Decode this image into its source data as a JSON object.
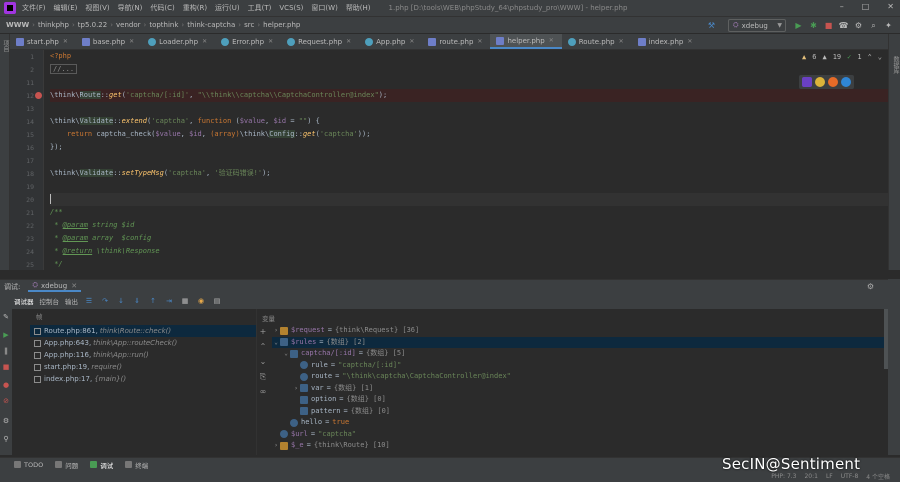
{
  "menubar": {
    "items": [
      "文件(F)",
      "编辑(E)",
      "视图(V)",
      "导航(N)",
      "代码(C)",
      "重构(R)",
      "运行(U)",
      "工具(T)",
      "VCS(S)",
      "窗口(W)",
      "帮助(H)"
    ],
    "title": "1.php [D:\\tools\\WEB\\phpStudy_64\\phpstudy_pro\\WWW] - helper.php"
  },
  "navbar": {
    "breadcrumbs": [
      "WWW",
      "thinkphp",
      "tp5.0.22",
      "vendor",
      "topthink",
      "think-captcha",
      "src",
      "helper.php"
    ],
    "run_config": "xdebug"
  },
  "tabs": [
    "start.php",
    "base.php",
    "Loader.php",
    "Error.php",
    "Request.php",
    "App.php",
    "route.php",
    "helper.php",
    "Route.php",
    "index.php"
  ],
  "active_tab": "helper.php",
  "editor": {
    "inspections": {
      "warnings": "6",
      "weak_warnings": "19",
      "typos": "1"
    },
    "lines": [
      {
        "n": "1",
        "text": "<?php"
      },
      {
        "n": "2",
        "text": "//..."
      },
      {
        "n": "11",
        "text": ""
      },
      {
        "n": "12",
        "text": "\\think\\Route::get('captcha/[:id]', \"\\\\think\\\\captcha\\\\CaptchaController@index\");"
      },
      {
        "n": "13",
        "text": ""
      },
      {
        "n": "14",
        "text": "\\think\\Validate::extend('captcha', function ($value, $id = \"\") {"
      },
      {
        "n": "15",
        "text": "    return captcha_check($value, $id, (array)\\think\\Config::get('captcha'));"
      },
      {
        "n": "16",
        "text": "});"
      },
      {
        "n": "17",
        "text": ""
      },
      {
        "n": "18",
        "text": "\\think\\Validate::setTypeMsg('captcha', '验证码错误!');"
      },
      {
        "n": "19",
        "text": ""
      },
      {
        "n": "20",
        "text": ""
      },
      {
        "n": "21",
        "text": "/**"
      },
      {
        "n": "22",
        "text": " * @param string $id"
      },
      {
        "n": "23",
        "text": " * @param array  $config"
      },
      {
        "n": "24",
        "text": " * @return \\think\\Response"
      },
      {
        "n": "25",
        "text": " */"
      }
    ],
    "code": {
      "l1_tag": "<?php",
      "l2_fold": "//...",
      "l12_ns": "\\think\\",
      "l12_cls": "Route",
      "l12_op": "::",
      "l12_fn": "get",
      "l12_args_open": "(",
      "l12_str1": "'captcha/[:id]'",
      "l12_comma": ", ",
      "l12_str2": "\"\\\\think\\\\captcha\\\\CaptchaController@index\"",
      "l12_close": ");",
      "l14_ns": "\\think\\",
      "l14_cls": "Validate",
      "l14_op": "::",
      "l14_fn": "extend",
      "l14_open": "(",
      "l14_str": "'captcha'",
      "l14_comma": ", ",
      "l14_kw": "function",
      "l14_p1": " (",
      "l14_v1": "$value",
      "l14_p2": ", ",
      "l14_v2": "$id",
      "l14_p3": " = ",
      "l14_str2": "\"\"",
      "l14_p4": ") {",
      "l15_indent": "    ",
      "l15_kw": "return",
      "l15_fn": " captcha_check(",
      "l15_v1": "$value",
      "l15_c1": ", ",
      "l15_v2": "$id",
      "l15_c2": ", ",
      "l15_cast": "(array)",
      "l15_ns": "\\think\\",
      "l15_cls": "Config",
      "l15_op": "::",
      "l15_fn2": "get",
      "l15_open": "(",
      "l15_str": "'captcha'",
      "l15_close": "));",
      "l16": "});",
      "l18_ns": "\\think\\",
      "l18_cls": "Validate",
      "l18_op": "::",
      "l18_fn": "setTypeMsg",
      "l18_open": "(",
      "l18_str1": "'captcha'",
      "l18_comma": ", ",
      "l18_str2": "'验证码错误!'",
      "l18_close": ");",
      "l21": "/**",
      "l22_star": " * ",
      "l22_tag": "@param",
      "l22_rest": " string $id",
      "l23_star": " * ",
      "l23_tag": "@param",
      "l23_rest": " array  $config",
      "l24_star": " * ",
      "l24_tag": "@return",
      "l24_rest": " \\think\\Response",
      "l25": " */"
    }
  },
  "debug": {
    "panel_label": "调试:",
    "session_tab": "xdebug",
    "toolbar": [
      "调试器",
      "控制台",
      "输出"
    ],
    "frames_header": "帧",
    "frames": [
      {
        "loc": "Route.php:861,",
        "method": "think\\Route::check()"
      },
      {
        "loc": "App.php:643,",
        "method": "think\\App::routeCheck()"
      },
      {
        "loc": "App.php:116,",
        "method": "think\\App::run()"
      },
      {
        "loc": "start.php:19,",
        "method": "require()"
      },
      {
        "loc": "index.php:17,",
        "method": "{main}()"
      }
    ],
    "vars_header": "变量",
    "vars": [
      {
        "name": "$request",
        "value": "{think\\Request} [36]"
      },
      {
        "name": "$rules",
        "value": "{数组} [2]"
      },
      {
        "name": "captcha/[:id]",
        "value": "{数组} [5]"
      },
      {
        "name": "rule",
        "value": "\"captcha/[:id]\""
      },
      {
        "name": "route",
        "value": "\"\\think\\captcha\\CaptchaController@index\""
      },
      {
        "name": "var",
        "value": "{数组} [1]"
      },
      {
        "name": "option",
        "value": "{数组} [0]"
      },
      {
        "name": "pattern",
        "value": "{数组} [0]"
      },
      {
        "name": "hello",
        "value": "true"
      },
      {
        "name": "$url",
        "value": "\"captcha\""
      },
      {
        "name": "$_e",
        "value": "{think\\Route} [10]"
      }
    ]
  },
  "bottom_tabs": [
    "TODO",
    "问题",
    "调试",
    "终端"
  ],
  "status": {
    "pos": "20:1",
    "eol": "LF",
    "enc": "UTF-8",
    "indent": "4 个空格",
    "php": "PHP: 7.3"
  },
  "watermark": "SecIN@Sentiment"
}
